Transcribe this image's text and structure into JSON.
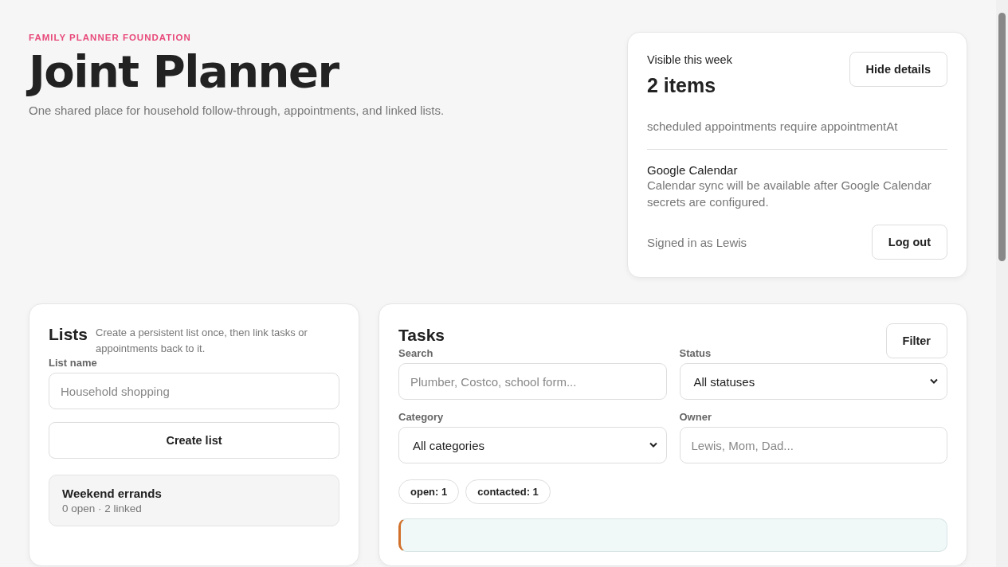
{
  "header": {
    "eyebrow": "FAMILY PLANNER FOUNDATION",
    "title": "Joint Planner",
    "subtitle": "One shared place for household follow-through, appointments, and linked lists."
  },
  "summary": {
    "label": "Visible this week",
    "count": "2 items",
    "toggle_button": "Hide details",
    "notice": "scheduled appointments require appointmentAt",
    "integration_title": "Google Calendar",
    "integration_text": "Calendar sync will be available after Google Calendar secrets are configured.",
    "signed_in": "Signed in as Lewis",
    "logout_button": "Log out"
  },
  "lists_panel": {
    "title": "Lists",
    "description": "Create a persistent list once, then link tasks or appointments back to it.",
    "field_label": "List name",
    "placeholder": "Household shopping",
    "create_button": "Create list",
    "lists": [
      {
        "name": "Weekend errands",
        "meta": "0 open · 2 linked"
      }
    ]
  },
  "tasks_panel": {
    "title": "Tasks",
    "filter_button": "Filter",
    "filters": [
      {
        "kind": "input",
        "label": "Search",
        "placeholder": "Plumber, Costco, school form..."
      },
      {
        "kind": "select",
        "label": "Status",
        "value": "All statuses"
      },
      {
        "kind": "select",
        "label": "Category",
        "value": "All categories"
      },
      {
        "kind": "input",
        "label": "Owner",
        "placeholder": "Lewis, Mom, Dad..."
      }
    ],
    "counts": [
      "open: **1**",
      "contacted: **1**"
    ]
  }
}
